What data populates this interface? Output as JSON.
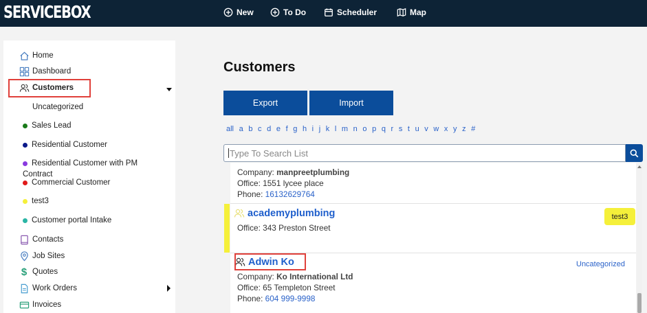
{
  "app": {
    "logo": "SERVICEBOX"
  },
  "topnav": [
    {
      "label": "New",
      "icon": "plus-circle-icon"
    },
    {
      "label": "To Do",
      "icon": "plus-circle-icon"
    },
    {
      "label": "Scheduler",
      "icon": "calendar-icon"
    },
    {
      "label": "Map",
      "icon": "map-icon"
    }
  ],
  "sidebar": {
    "items": [
      {
        "label": "Home",
        "icon": "home-icon"
      },
      {
        "label": "Dashboard",
        "icon": "dashboard-icon"
      },
      {
        "label": "Customers",
        "icon": "users-icon"
      },
      {
        "label": "Contacts",
        "icon": "book-icon"
      },
      {
        "label": "Job Sites",
        "icon": "map-pin-icon"
      },
      {
        "label": "Quotes",
        "icon": "dollar-icon"
      },
      {
        "label": "Work Orders",
        "icon": "document-icon"
      },
      {
        "label": "Invoices",
        "icon": "card-icon"
      }
    ],
    "customer_types": [
      {
        "label": "Uncategorized",
        "color": ""
      },
      {
        "label": "Sales Lead",
        "color": "#1a7a1a"
      },
      {
        "label": "Residential Customer",
        "color": "#0b1a8a"
      },
      {
        "label": "Residential Customer with PM",
        "label2": "Contract",
        "color": "#8a3ae0"
      },
      {
        "label": "Commercial Customer",
        "color": "#e01a1a"
      },
      {
        "label": "test3",
        "color": "#f5f03a"
      },
      {
        "label": "Customer portal Intake",
        "color": "#2ab5a5"
      }
    ]
  },
  "main": {
    "title": "Customers",
    "export_label": "Export",
    "import_label": "Import",
    "alphabet": [
      "all",
      "a",
      "b",
      "c",
      "d",
      "e",
      "f",
      "g",
      "h",
      "i",
      "j",
      "k",
      "l",
      "m",
      "n",
      "o",
      "p",
      "q",
      "r",
      "s",
      "t",
      "u",
      "v",
      "w",
      "x",
      "y",
      "z",
      "#"
    ],
    "search_placeholder": "Type To Search List"
  },
  "customers": [
    {
      "company_label": "Company:",
      "company": "manpreetplumbing",
      "office_label": "Office:",
      "office": "1551 lycee place",
      "phone_label": "Phone:",
      "phone": "16132629764"
    },
    {
      "name": "academyplumbing",
      "office_label": "Office:",
      "office": "343 Preston Street",
      "badge": "test3",
      "accent": "#f5f03a"
    },
    {
      "name": "Adwin Ko",
      "category": "Uncategorized",
      "company_label": "Company:",
      "company": "Ko International Ltd",
      "office_label": "Office:",
      "office": "65 Templeton Street",
      "phone_label": "Phone:",
      "phone": "604 999-9998"
    }
  ],
  "colors": {
    "topbar": "#0d2336",
    "primary": "#0b4d9b",
    "link": "#1f5fcc",
    "highlight": "#e0403a"
  }
}
